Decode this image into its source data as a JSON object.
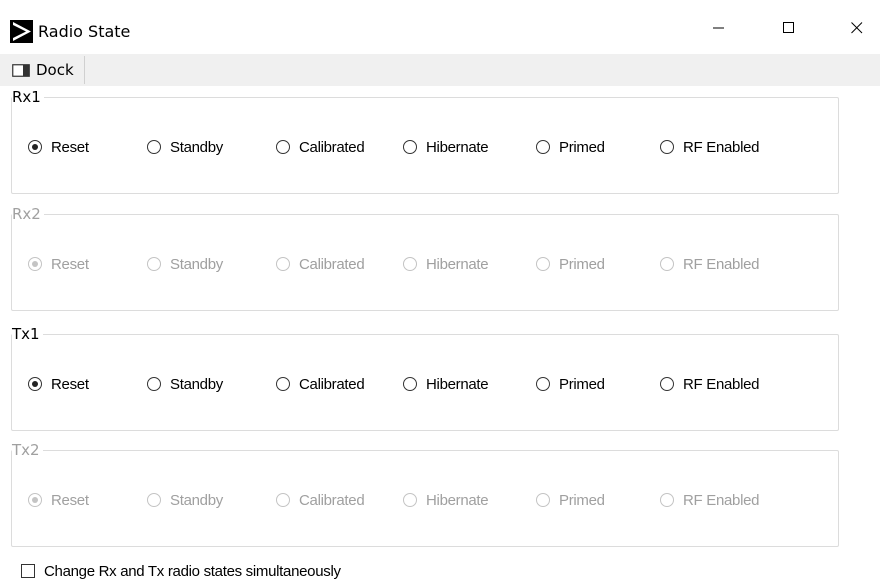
{
  "window": {
    "title": "Radio State",
    "minimize_glyph": "–",
    "maximize_glyph": "☐",
    "close_glyph": "✕"
  },
  "toolbar": {
    "dock_label": "Dock",
    "dock_icon": "dock-window-icon"
  },
  "groups": [
    {
      "label": "Rx1",
      "enabled": true,
      "options": [
        "Reset",
        "Standby",
        "Calibrated",
        "Hibernate",
        "Primed",
        "RF Enabled"
      ],
      "selected": "Reset"
    },
    {
      "label": "Rx2",
      "enabled": false,
      "options": [
        "Reset",
        "Standby",
        "Calibrated",
        "Hibernate",
        "Primed",
        "RF Enabled"
      ],
      "selected": "Reset"
    },
    {
      "label": "Tx1",
      "enabled": true,
      "options": [
        "Reset",
        "Standby",
        "Calibrated",
        "Hibernate",
        "Primed",
        "RF Enabled"
      ],
      "selected": "Reset"
    },
    {
      "label": "Tx2",
      "enabled": false,
      "options": [
        "Reset",
        "Standby",
        "Calibrated",
        "Hibernate",
        "Primed",
        "RF Enabled"
      ],
      "selected": "Reset"
    }
  ],
  "footer": {
    "simultaneous_label": "Change Rx and Tx radio states simultaneously",
    "checked": false
  },
  "colors": {
    "disabled_text": "#a0a0a0",
    "toolbar_bg": "#f0f0f0"
  }
}
